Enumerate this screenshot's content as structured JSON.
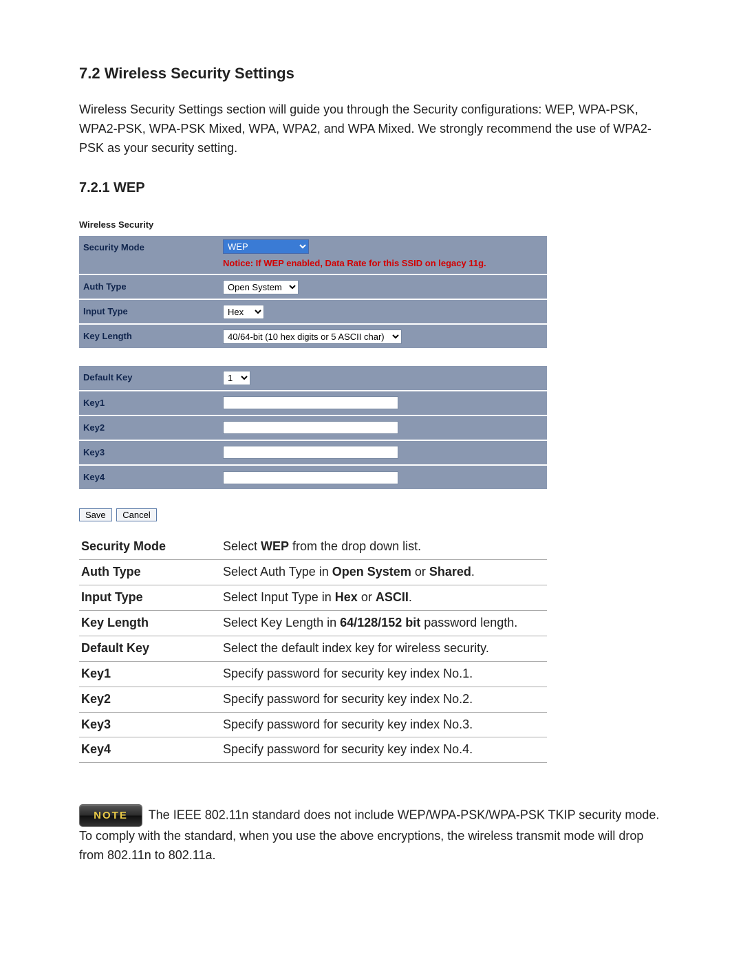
{
  "section_title": "7.2 Wireless Security Settings",
  "intro": "Wireless Security Settings section will guide you through the Security configurations: WEP, WPA-PSK, WPA2-PSK, WPA-PSK Mixed, WPA, WPA2, and WPA Mixed. We strongly recommend the use of WPA2-PSK as your security setting.",
  "subsection_title": "7.2.1 WEP",
  "panel": {
    "header": "Wireless Security",
    "rows1": {
      "security_mode": {
        "label": "Security Mode",
        "value": "WEP",
        "notice": "Notice: If WEP enabled, Data Rate for this SSID on legacy 11g."
      },
      "auth_type": {
        "label": "Auth Type",
        "value": "Open System"
      },
      "input_type": {
        "label": "Input Type",
        "value": "Hex"
      },
      "key_length": {
        "label": "Key Length",
        "value": "40/64-bit (10 hex digits or 5 ASCII char)"
      }
    },
    "rows2": {
      "default_key": {
        "label": "Default Key",
        "value": "1"
      },
      "key1": {
        "label": "Key1",
        "value": ""
      },
      "key2": {
        "label": "Key2",
        "value": ""
      },
      "key3": {
        "label": "Key3",
        "value": ""
      },
      "key4": {
        "label": "Key4",
        "value": ""
      }
    },
    "buttons": {
      "save": "Save",
      "cancel": "Cancel"
    }
  },
  "desc": [
    {
      "term": "Security Mode",
      "text_pre": "Select ",
      "bold1": "WEP",
      "text_mid": " from the drop down list.",
      "bold2": "",
      "text_post": ""
    },
    {
      "term": "Auth Type",
      "text_pre": "Select Auth Type in ",
      "bold1": "Open System",
      "text_mid": " or ",
      "bold2": "Shared",
      "text_post": "."
    },
    {
      "term": "Input Type",
      "text_pre": "Select Input Type in ",
      "bold1": "Hex",
      "text_mid": " or ",
      "bold2": "ASCII",
      "text_post": "."
    },
    {
      "term": "Key Length",
      "text_pre": "Select Key Length in ",
      "bold1": "64/128/152 bit",
      "text_mid": " password length.",
      "bold2": "",
      "text_post": ""
    },
    {
      "term": "Default Key",
      "text_pre": "Select the default index key for wireless security.",
      "bold1": "",
      "text_mid": "",
      "bold2": "",
      "text_post": ""
    },
    {
      "term": "Key1",
      "text_pre": "Specify password for security key index No.1.",
      "bold1": "",
      "text_mid": "",
      "bold2": "",
      "text_post": ""
    },
    {
      "term": "Key2",
      "text_pre": "Specify password for security key index No.2.",
      "bold1": "",
      "text_mid": "",
      "bold2": "",
      "text_post": ""
    },
    {
      "term": "Key3",
      "text_pre": "Specify password for security key index No.3.",
      "bold1": "",
      "text_mid": "",
      "bold2": "",
      "text_post": ""
    },
    {
      "term": "Key4",
      "text_pre": "Specify password for security key index No.4.",
      "bold1": "",
      "text_mid": "",
      "bold2": "",
      "text_post": ""
    }
  ],
  "note": {
    "badge": "NOTE",
    "text": " The IEEE 802.11n standard does not include WEP/WPA-PSK/WPA-PSK TKIP security mode. To comply with the standard, when you use the above encryptions, the wireless transmit mode will drop from 802.11n to 802.11a."
  }
}
